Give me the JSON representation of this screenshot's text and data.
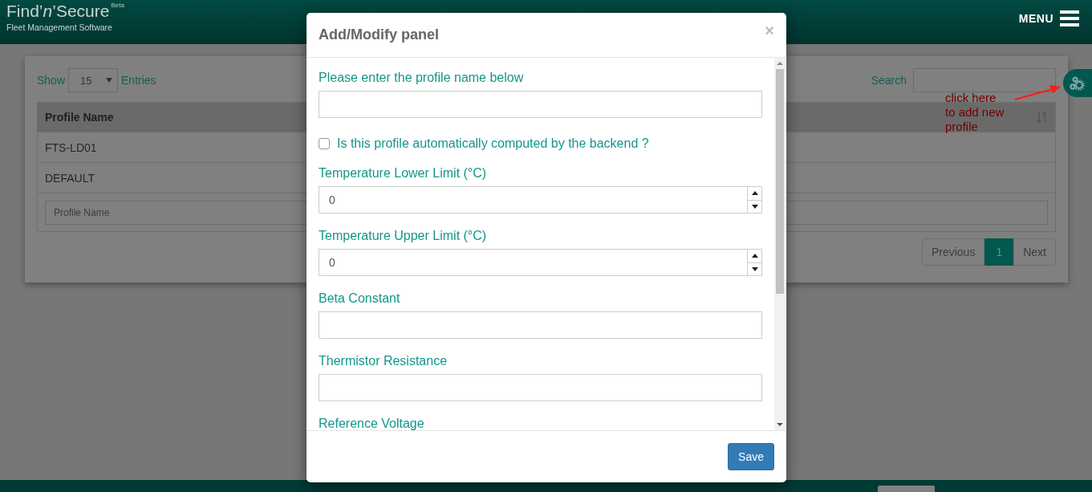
{
  "header": {
    "logo": "Find’*n*’Secure",
    "logo_badge": "Beta",
    "logo_tagline": "Fleet Management Software",
    "menu_label": "MENU"
  },
  "toolbar": {
    "show_label": "Show",
    "entries_value": "15",
    "entries_label": "Entries",
    "search_label": "Search"
  },
  "table": {
    "columns": [
      "Profile Name"
    ],
    "rows": [
      [
        "FTS-LD01"
      ],
      [
        "DEFAULT"
      ]
    ],
    "filter_placeholder": "Profile Name"
  },
  "pagination": [
    {
      "label": "Previous",
      "selected": false
    },
    {
      "label": "1",
      "selected": true
    },
    {
      "label": "Next",
      "selected": false
    }
  ],
  "annotation": {
    "lines": [
      "click here",
      "to add new",
      "profile"
    ]
  },
  "modal": {
    "title": "Add/Modify panel",
    "close": "×",
    "fields": [
      {
        "kind": "text",
        "label": "Please enter the profile name below"
      },
      {
        "kind": "checkbox",
        "label": "Is this profile automatically computed by the backend ?",
        "checked": false
      },
      {
        "kind": "number",
        "label": "Temperature Lower Limit (°C)",
        "value": "0"
      },
      {
        "kind": "number",
        "label": "Temperature Upper Limit (°C)",
        "value": "0"
      },
      {
        "kind": "text",
        "label": "Beta Constant"
      },
      {
        "kind": "text",
        "label": "Thermistor Resistance"
      },
      {
        "kind": "text",
        "label": "Reference Voltage"
      }
    ],
    "save": "Save"
  }
}
